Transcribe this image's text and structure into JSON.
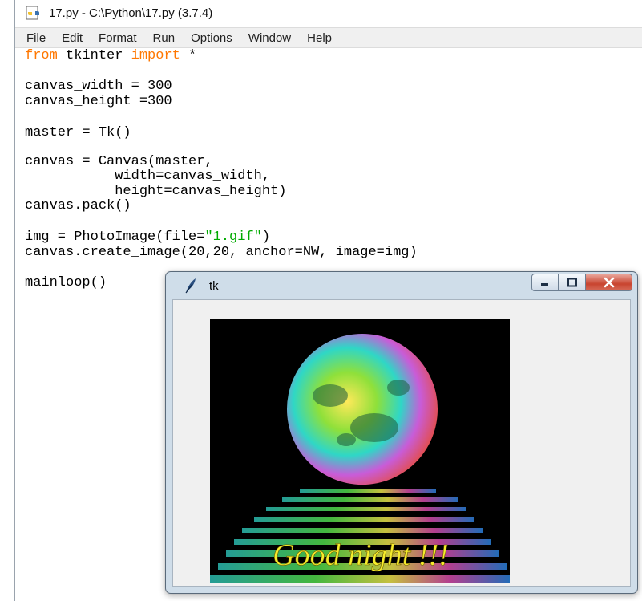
{
  "idle": {
    "title": "17.py - C:\\Python\\17.py (3.7.4)",
    "menu": [
      "File",
      "Edit",
      "Format",
      "Run",
      "Options",
      "Window",
      "Help"
    ]
  },
  "code": [
    {
      "tokens": [
        {
          "t": "from",
          "c": "kw"
        },
        {
          "t": " tkinter "
        },
        {
          "t": "import",
          "c": "kw"
        },
        {
          "t": " *"
        }
      ]
    },
    {
      "tokens": []
    },
    {
      "tokens": [
        {
          "t": "canvas_width = 300"
        }
      ]
    },
    {
      "tokens": [
        {
          "t": "canvas_height =300"
        }
      ]
    },
    {
      "tokens": []
    },
    {
      "tokens": [
        {
          "t": "master = Tk()"
        }
      ]
    },
    {
      "tokens": []
    },
    {
      "tokens": [
        {
          "t": "canvas = Canvas(master,"
        }
      ]
    },
    {
      "tokens": [
        {
          "t": "           width=canvas_width,"
        }
      ]
    },
    {
      "tokens": [
        {
          "t": "           height=canvas_height)"
        }
      ]
    },
    {
      "tokens": [
        {
          "t": "canvas.pack()"
        }
      ]
    },
    {
      "tokens": []
    },
    {
      "tokens": [
        {
          "t": "img = PhotoImage(file="
        },
        {
          "t": "\"1.gif\"",
          "c": "str"
        },
        {
          "t": ")"
        }
      ]
    },
    {
      "tokens": [
        {
          "t": "canvas.create_image(20,20, anchor=NW, image=img)"
        }
      ]
    },
    {
      "tokens": []
    },
    {
      "tokens": [
        {
          "t": "mainloop()"
        }
      ]
    }
  ],
  "tk_window": {
    "title": "tk",
    "image_caption": "Good night !!!"
  },
  "colors": {
    "keyword": "#ff7700",
    "string": "#00aa00",
    "window_frame": "#cfdde9",
    "close_button": "#c8442f"
  },
  "icons": {
    "idle_title": "python-file-icon",
    "tk_title": "tk-feather-icon",
    "minimize": "minimize-icon",
    "maximize": "maximize-icon",
    "close": "close-icon"
  }
}
